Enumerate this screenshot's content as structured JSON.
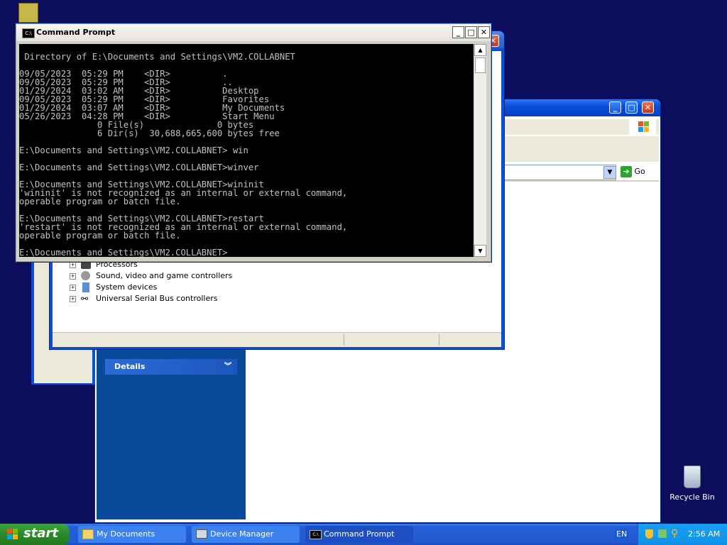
{
  "desktop": {
    "recycle_bin_label": "Recycle Bin"
  },
  "cmd": {
    "title": "Command Prompt",
    "lines": [
      "",
      " Directory of E:\\Documents and Settings\\VM2.COLLABNET",
      "",
      "09/05/2023  05:29 PM    <DIR>          .",
      "09/05/2023  05:29 PM    <DIR>          ..",
      "01/29/2024  03:02 AM    <DIR>          Desktop",
      "09/05/2023  05:29 PM    <DIR>          Favorites",
      "01/29/2024  03:07 AM    <DIR>          My Documents",
      "05/26/2023  04:28 PM    <DIR>          Start Menu",
      "               0 File(s)              0 bytes",
      "               6 Dir(s)  30,688,665,600 bytes free",
      "",
      "E:\\Documents and Settings\\VM2.COLLABNET> win",
      "",
      "E:\\Documents and Settings\\VM2.COLLABNET>winver",
      "",
      "E:\\Documents and Settings\\VM2.COLLABNET>wininit",
      "'wininit' is not recognized as an internal or external command,",
      "operable program or batch file.",
      "",
      "E:\\Documents and Settings\\VM2.COLLABNET>restart",
      "'restart' is not recognized as an internal or external command,",
      "operable program or batch file.",
      "",
      "E:\\Documents and Settings\\VM2.COLLABNET>"
    ]
  },
  "device_manager": {
    "tree_items": [
      {
        "label": "Processors",
        "icon": "processor-icon"
      },
      {
        "label": "Sound, video and game controllers",
        "icon": "sound-icon"
      },
      {
        "label": "System devices",
        "icon": "system-devices-icon"
      },
      {
        "label": "Universal Serial Bus controllers",
        "icon": "usb-icon"
      }
    ]
  },
  "explorer": {
    "go_label": "Go",
    "details_label": "Details"
  },
  "taskbar": {
    "start_label": "start",
    "items": [
      {
        "label": "My Documents",
        "icon": "folder-icon"
      },
      {
        "label": "Device Manager",
        "icon": "computer-icon"
      },
      {
        "label": "Command Prompt",
        "icon": "cmd-icon"
      }
    ],
    "language": "EN",
    "clock": "2:56 AM"
  },
  "colors": {
    "desktop_bg": "#0c0d5c",
    "xp_blue": "#0a4fd9",
    "task_pane": "#0a4a9a"
  }
}
